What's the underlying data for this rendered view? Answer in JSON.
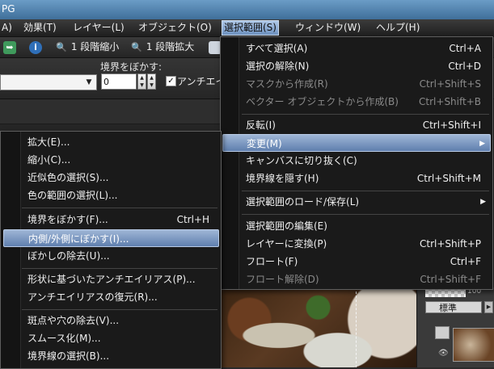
{
  "titlebar": {
    "text": "PG"
  },
  "menubar": {
    "items": [
      {
        "label": "A)",
        "active": false
      },
      {
        "label": "効果(T)",
        "active": false
      },
      {
        "label": "レイヤー(L)",
        "active": false
      },
      {
        "label": "オブジェクト(O)",
        "active": false
      },
      {
        "label": "選択範囲(S)",
        "active": true
      },
      {
        "label": "ウィンドウ(W)",
        "active": false
      },
      {
        "label": "ヘルプ(H)",
        "active": false
      }
    ]
  },
  "toolbar": {
    "zoom_out_label": "1 段階縮小",
    "zoom_in_label": "1 段階拡大"
  },
  "options": {
    "feather_label": "境界をぼかす:",
    "feather_value": "0",
    "antialias_label": "アンチエイリ"
  },
  "selection_menu": {
    "items": [
      {
        "label": "すべて選択(A)",
        "shortcut": "Ctrl+A",
        "disabled": false
      },
      {
        "label": "選択の解除(N)",
        "shortcut": "Ctrl+D",
        "disabled": false
      },
      {
        "label": "マスクから作成(R)",
        "shortcut": "Ctrl+Shift+S",
        "disabled": true
      },
      {
        "label": "ベクター オブジェクトから作成(B)",
        "shortcut": "Ctrl+Shift+B",
        "disabled": true
      },
      {
        "label": "反転(I)",
        "shortcut": "Ctrl+Shift+I",
        "disabled": false
      },
      {
        "label": "変更(M)",
        "shortcut": "",
        "disabled": false,
        "highlighted": true,
        "submenu": true
      },
      {
        "label": "キャンバスに切り抜く(C)",
        "shortcut": "",
        "disabled": false
      },
      {
        "label": "境界線を隠す(H)",
        "shortcut": "Ctrl+Shift+M",
        "disabled": false
      },
      {
        "label": "選択範囲のロード/保存(L)",
        "shortcut": "",
        "disabled": false,
        "submenu": true
      },
      {
        "label": "選択範囲の編集(E)",
        "shortcut": "",
        "disabled": false
      },
      {
        "label": "レイヤーに変換(P)",
        "shortcut": "Ctrl+Shift+P",
        "disabled": false
      },
      {
        "label": "フロート(F)",
        "shortcut": "Ctrl+F",
        "disabled": false
      },
      {
        "label": "フロート解除(D)",
        "shortcut": "Ctrl+Shift+F",
        "disabled": true
      }
    ]
  },
  "modify_submenu": {
    "items": [
      {
        "label": "拡大(E)...",
        "shortcut": ""
      },
      {
        "label": "縮小(C)...",
        "shortcut": ""
      },
      {
        "label": "近似色の選択(S)...",
        "shortcut": ""
      },
      {
        "label": "色の範囲の選択(L)...",
        "shortcut": ""
      },
      {
        "label": "境界をぼかす(F)...",
        "shortcut": "Ctrl+H"
      },
      {
        "label": "内側/外側にぼかす(I)...",
        "shortcut": "",
        "highlighted": true
      },
      {
        "label": "ぼかしの除去(U)...",
        "shortcut": ""
      },
      {
        "label": "形状に基づいたアンチエイリアス(P)...",
        "shortcut": ""
      },
      {
        "label": "アンチエイリアスの復元(R)...",
        "shortcut": ""
      },
      {
        "label": "斑点や穴の除去(V)...",
        "shortcut": ""
      },
      {
        "label": "スムース化(M)...",
        "shortcut": ""
      },
      {
        "label": "境界線の選択(B)...",
        "shortcut": ""
      }
    ]
  },
  "layers_panel": {
    "opacity_value": "100",
    "blend_mode": "標準"
  },
  "colors": {
    "highlight": "#6f8fbd",
    "menu_bg": "#1a1a1a"
  }
}
